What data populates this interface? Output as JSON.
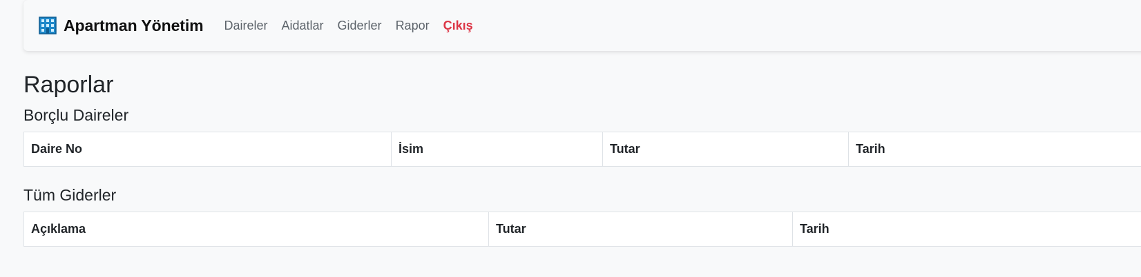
{
  "navbar": {
    "brand_icon": "building-icon",
    "brand": "Apartman Yönetim",
    "links": [
      {
        "label": "Daireler"
      },
      {
        "label": "Aidatlar"
      },
      {
        "label": "Giderler"
      },
      {
        "label": "Rapor"
      },
      {
        "label": "Çıkış"
      }
    ]
  },
  "page": {
    "title": "Raporlar"
  },
  "debtors": {
    "title": "Borçlu Daireler",
    "columns": [
      "Daire No",
      "İsim",
      "Tutar",
      "Tarih"
    ]
  },
  "expenses": {
    "title": "Tüm Giderler",
    "columns": [
      "Açıklama",
      "Tutar",
      "Tarih"
    ]
  },
  "colors": {
    "logout": "#dc3545",
    "nav_link": "#5c636a",
    "background": "#f8f9fa"
  }
}
